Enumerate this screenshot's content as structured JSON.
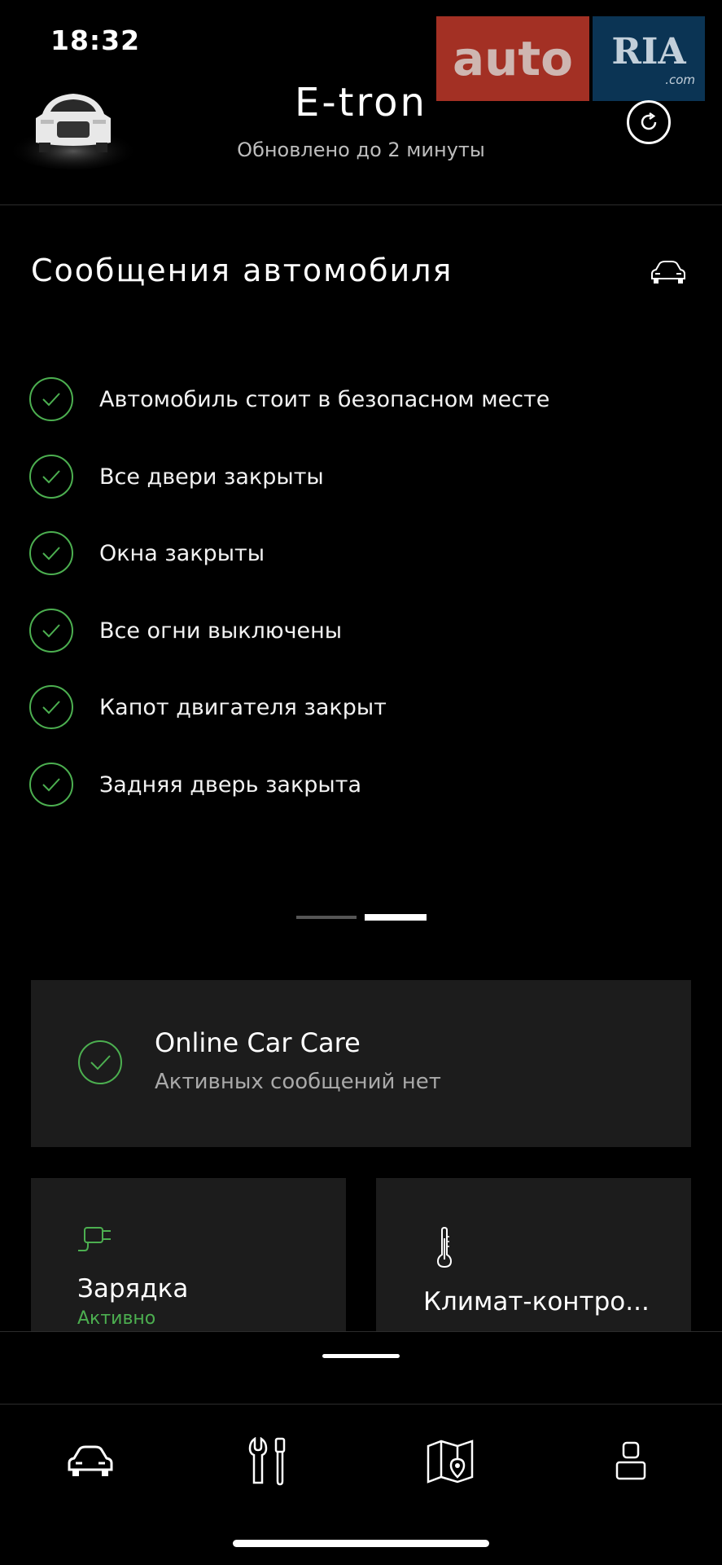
{
  "status_bar": {
    "time": "18:32"
  },
  "header": {
    "title": "E-tron",
    "subtitle": "Обновлено до 2 минуты",
    "icons": {
      "car_thumbnail": "car-front-image",
      "refresh": "refresh-icon"
    }
  },
  "watermark": {
    "left": "auto",
    "right": "RIA",
    "domain": ".com"
  },
  "messages": {
    "title": "Сообщения автомобиля",
    "items": [
      {
        "label": "Автомобиль стоит в безопасном месте",
        "status": "ok"
      },
      {
        "label": "Все двери закрыты",
        "status": "ok"
      },
      {
        "label": "Окна закрыты",
        "status": "ok"
      },
      {
        "label": "Все огни выключены",
        "status": "ok"
      },
      {
        "label": "Капот двигателя закрыт",
        "status": "ok"
      },
      {
        "label": "Задняя дверь закрыта",
        "status": "ok"
      }
    ],
    "pager": {
      "count": 2,
      "active_index": 1
    }
  },
  "care": {
    "title": "Online Car Care",
    "subtitle": "Активных сообщений нет"
  },
  "tiles": [
    {
      "label": "Зарядка",
      "status": "Активно",
      "icon": "charging-plug-icon"
    },
    {
      "label": "Климат-контро...",
      "icon": "thermometer-icon"
    }
  ],
  "tabbar": {
    "tabs": [
      {
        "name": "vehicle",
        "icon": "car-icon"
      },
      {
        "name": "service",
        "icon": "tools-icon"
      },
      {
        "name": "map",
        "icon": "map-icon"
      },
      {
        "name": "profile",
        "icon": "person-icon"
      }
    ]
  },
  "colors": {
    "background": "#000000",
    "accent_green": "#4caf50",
    "card": "#1c1c1c"
  }
}
